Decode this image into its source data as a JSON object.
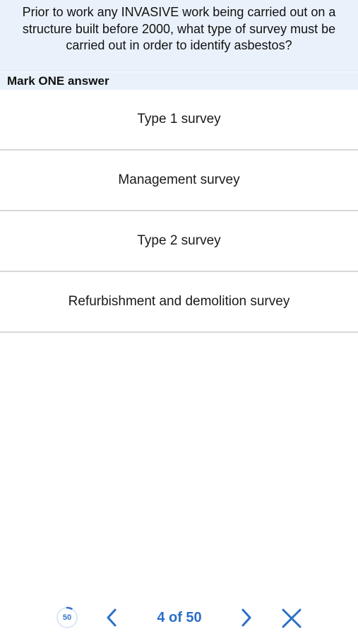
{
  "question": {
    "text": "Prior to work any INVASIVE work being carried out on a structure built before 2000, what type of survey must be carried out in order to identify asbestos?",
    "instruction": "Mark ONE answer"
  },
  "answers": [
    "Type 1 survey",
    "Management survey",
    "Type 2 survey",
    "Refurbishment and demolition survey"
  ],
  "footer": {
    "timer_label": "50",
    "timer_progress": 0.08,
    "counter": "4 of 50",
    "icons": {
      "timer": "timer-icon",
      "previous": "chevron-left-icon",
      "next": "chevron-right-icon",
      "close": "close-icon"
    }
  },
  "colors": {
    "question_background": "#e9f2fb",
    "accent": "#2a6fc7",
    "divider": "#d8d8d8"
  }
}
